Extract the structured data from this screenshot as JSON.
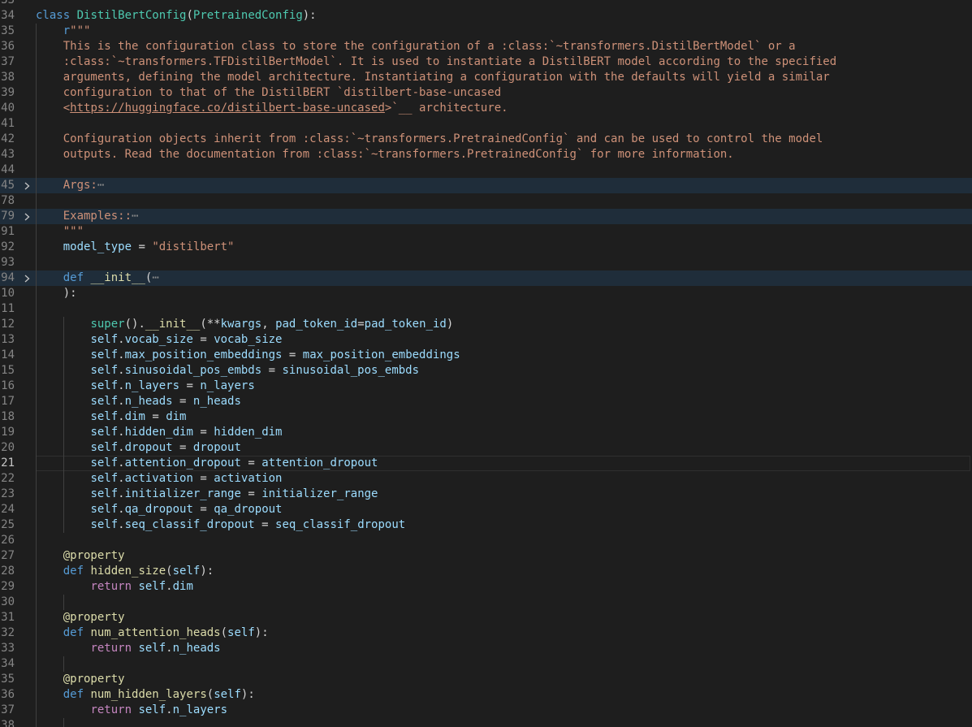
{
  "editor": {
    "language": "python",
    "active_line": "21",
    "colors": {
      "background": "#1e1e1e",
      "keyword": "#569cd6",
      "class": "#4ec9b0",
      "string": "#ce9178",
      "function": "#dcdcaa",
      "variable": "#9cdcfe",
      "control": "#c586c0",
      "folded_bg": "#1f2d3a"
    },
    "lines": [
      {
        "num": "33",
        "tokens": []
      },
      {
        "num": "34",
        "tokens": [
          [
            "kw",
            "class"
          ],
          [
            "txt",
            " "
          ],
          [
            "cls",
            "DistilBertConfig"
          ],
          [
            "txt",
            "("
          ],
          [
            "cls",
            "PretrainedConfig"
          ],
          [
            "txt",
            "):"
          ]
        ]
      },
      {
        "num": "35",
        "tokens": [
          [
            "txt",
            "    "
          ],
          [
            "kw",
            "r"
          ],
          [
            "str",
            "\"\"\""
          ]
        ]
      },
      {
        "num": "36",
        "tokens": [
          [
            "str",
            "    This is the configuration class to store the configuration of a :class:`~transformers.DistilBertModel` or a"
          ]
        ]
      },
      {
        "num": "37",
        "tokens": [
          [
            "str",
            "    :class:`~transformers.TFDistilBertModel`. It is used to instantiate a DistilBERT model according to the specified"
          ]
        ]
      },
      {
        "num": "38",
        "tokens": [
          [
            "str",
            "    arguments, defining the model architecture. Instantiating a configuration with the defaults will yield a similar"
          ]
        ]
      },
      {
        "num": "39",
        "tokens": [
          [
            "str",
            "    configuration to that of the DistilBERT `distilbert-base-uncased"
          ]
        ]
      },
      {
        "num": "40",
        "tokens": [
          [
            "str",
            "    <"
          ],
          [
            "link",
            "https://huggingface.co/distilbert-base-uncased"
          ],
          [
            "str",
            ">`__ architecture."
          ]
        ]
      },
      {
        "num": "41",
        "tokens": []
      },
      {
        "num": "42",
        "tokens": [
          [
            "str",
            "    Configuration objects inherit from :class:`~transformers.PretrainedConfig` and can be used to control the model"
          ]
        ]
      },
      {
        "num": "43",
        "tokens": [
          [
            "str",
            "    outputs. Read the documentation from :class:`~transformers.PretrainedConfig` for more information."
          ]
        ]
      },
      {
        "num": "44",
        "tokens": []
      },
      {
        "num": "45",
        "folded": true,
        "tokens": [
          [
            "str",
            "    Args:"
          ],
          [
            "ell",
            "⋯"
          ]
        ]
      },
      {
        "num": "78",
        "tokens": []
      },
      {
        "num": "79",
        "folded": true,
        "tokens": [
          [
            "str",
            "    Examples::"
          ],
          [
            "ell",
            "⋯"
          ]
        ]
      },
      {
        "num": "91",
        "tokens": [
          [
            "str",
            "    \"\"\""
          ]
        ]
      },
      {
        "num": "92",
        "tokens": [
          [
            "txt",
            "    "
          ],
          [
            "var",
            "model_type"
          ],
          [
            "txt",
            " = "
          ],
          [
            "str",
            "\"distilbert\""
          ]
        ]
      },
      {
        "num": "93",
        "tokens": []
      },
      {
        "num": "94",
        "folded": true,
        "tokens": [
          [
            "txt",
            "    "
          ],
          [
            "kw",
            "def"
          ],
          [
            "txt",
            " "
          ],
          [
            "fn",
            "__init__"
          ],
          [
            "txt",
            "("
          ],
          [
            "ell",
            "⋯"
          ]
        ]
      },
      {
        "num": "10",
        "tokens": [
          [
            "txt",
            "    ):"
          ]
        ]
      },
      {
        "num": "11",
        "tokens": []
      },
      {
        "num": "12",
        "tokens": [
          [
            "txt",
            "        "
          ],
          [
            "cls",
            "super"
          ],
          [
            "txt",
            "()."
          ],
          [
            "fn",
            "__init__"
          ],
          [
            "txt",
            "(**"
          ],
          [
            "var",
            "kwargs"
          ],
          [
            "txt",
            ", "
          ],
          [
            "var",
            "pad_token_id"
          ],
          [
            "txt",
            "="
          ],
          [
            "var",
            "pad_token_id"
          ],
          [
            "txt",
            ")"
          ]
        ]
      },
      {
        "num": "13",
        "tokens": [
          [
            "txt",
            "        "
          ],
          [
            "var",
            "self"
          ],
          [
            "txt",
            "."
          ],
          [
            "var",
            "vocab_size"
          ],
          [
            "txt",
            " = "
          ],
          [
            "var",
            "vocab_size"
          ]
        ]
      },
      {
        "num": "14",
        "tokens": [
          [
            "txt",
            "        "
          ],
          [
            "var",
            "self"
          ],
          [
            "txt",
            "."
          ],
          [
            "var",
            "max_position_embeddings"
          ],
          [
            "txt",
            " = "
          ],
          [
            "var",
            "max_position_embeddings"
          ]
        ]
      },
      {
        "num": "15",
        "tokens": [
          [
            "txt",
            "        "
          ],
          [
            "var",
            "self"
          ],
          [
            "txt",
            "."
          ],
          [
            "var",
            "sinusoidal_pos_embds"
          ],
          [
            "txt",
            " = "
          ],
          [
            "var",
            "sinusoidal_pos_embds"
          ]
        ]
      },
      {
        "num": "16",
        "tokens": [
          [
            "txt",
            "        "
          ],
          [
            "var",
            "self"
          ],
          [
            "txt",
            "."
          ],
          [
            "var",
            "n_layers"
          ],
          [
            "txt",
            " = "
          ],
          [
            "var",
            "n_layers"
          ]
        ]
      },
      {
        "num": "17",
        "tokens": [
          [
            "txt",
            "        "
          ],
          [
            "var",
            "self"
          ],
          [
            "txt",
            "."
          ],
          [
            "var",
            "n_heads"
          ],
          [
            "txt",
            " = "
          ],
          [
            "var",
            "n_heads"
          ]
        ]
      },
      {
        "num": "18",
        "tokens": [
          [
            "txt",
            "        "
          ],
          [
            "var",
            "self"
          ],
          [
            "txt",
            "."
          ],
          [
            "var",
            "dim"
          ],
          [
            "txt",
            " = "
          ],
          [
            "var",
            "dim"
          ]
        ]
      },
      {
        "num": "19",
        "tokens": [
          [
            "txt",
            "        "
          ],
          [
            "var",
            "self"
          ],
          [
            "txt",
            "."
          ],
          [
            "var",
            "hidden_dim"
          ],
          [
            "txt",
            " = "
          ],
          [
            "var",
            "hidden_dim"
          ]
        ]
      },
      {
        "num": "20",
        "tokens": [
          [
            "txt",
            "        "
          ],
          [
            "var",
            "self"
          ],
          [
            "txt",
            "."
          ],
          [
            "var",
            "dropout"
          ],
          [
            "txt",
            " = "
          ],
          [
            "var",
            "dropout"
          ]
        ]
      },
      {
        "num": "21",
        "tokens": [
          [
            "txt",
            "        "
          ],
          [
            "var",
            "self"
          ],
          [
            "txt",
            "."
          ],
          [
            "var",
            "attention_dropout"
          ],
          [
            "txt",
            " = "
          ],
          [
            "var",
            "attention_dropout"
          ]
        ]
      },
      {
        "num": "22",
        "tokens": [
          [
            "txt",
            "        "
          ],
          [
            "var",
            "self"
          ],
          [
            "txt",
            "."
          ],
          [
            "var",
            "activation"
          ],
          [
            "txt",
            " = "
          ],
          [
            "var",
            "activation"
          ]
        ]
      },
      {
        "num": "23",
        "tokens": [
          [
            "txt",
            "        "
          ],
          [
            "var",
            "self"
          ],
          [
            "txt",
            "."
          ],
          [
            "var",
            "initializer_range"
          ],
          [
            "txt",
            " = "
          ],
          [
            "var",
            "initializer_range"
          ]
        ]
      },
      {
        "num": "24",
        "tokens": [
          [
            "txt",
            "        "
          ],
          [
            "var",
            "self"
          ],
          [
            "txt",
            "."
          ],
          [
            "var",
            "qa_dropout"
          ],
          [
            "txt",
            " = "
          ],
          [
            "var",
            "qa_dropout"
          ]
        ]
      },
      {
        "num": "25",
        "tokens": [
          [
            "txt",
            "        "
          ],
          [
            "var",
            "self"
          ],
          [
            "txt",
            "."
          ],
          [
            "var",
            "seq_classif_dropout"
          ],
          [
            "txt",
            " = "
          ],
          [
            "var",
            "seq_classif_dropout"
          ]
        ]
      },
      {
        "num": "26",
        "tokens": []
      },
      {
        "num": "27",
        "tokens": [
          [
            "txt",
            "    "
          ],
          [
            "fn",
            "@property"
          ]
        ]
      },
      {
        "num": "28",
        "tokens": [
          [
            "txt",
            "    "
          ],
          [
            "kw",
            "def"
          ],
          [
            "txt",
            " "
          ],
          [
            "fn",
            "hidden_size"
          ],
          [
            "txt",
            "("
          ],
          [
            "var",
            "self"
          ],
          [
            "txt",
            "):"
          ]
        ]
      },
      {
        "num": "29",
        "tokens": [
          [
            "txt",
            "        "
          ],
          [
            "ctl",
            "return"
          ],
          [
            "txt",
            " "
          ],
          [
            "var",
            "self"
          ],
          [
            "txt",
            "."
          ],
          [
            "var",
            "dim"
          ]
        ]
      },
      {
        "num": "30",
        "tokens": []
      },
      {
        "num": "31",
        "tokens": [
          [
            "txt",
            "    "
          ],
          [
            "fn",
            "@property"
          ]
        ]
      },
      {
        "num": "32",
        "tokens": [
          [
            "txt",
            "    "
          ],
          [
            "kw",
            "def"
          ],
          [
            "txt",
            " "
          ],
          [
            "fn",
            "num_attention_heads"
          ],
          [
            "txt",
            "("
          ],
          [
            "var",
            "self"
          ],
          [
            "txt",
            "):"
          ]
        ]
      },
      {
        "num": "33",
        "tokens": [
          [
            "txt",
            "        "
          ],
          [
            "ctl",
            "return"
          ],
          [
            "txt",
            " "
          ],
          [
            "var",
            "self"
          ],
          [
            "txt",
            "."
          ],
          [
            "var",
            "n_heads"
          ]
        ]
      },
      {
        "num": "34",
        "tokens": []
      },
      {
        "num": "35",
        "tokens": [
          [
            "txt",
            "    "
          ],
          [
            "fn",
            "@property"
          ]
        ]
      },
      {
        "num": "36",
        "tokens": [
          [
            "txt",
            "    "
          ],
          [
            "kw",
            "def"
          ],
          [
            "txt",
            " "
          ],
          [
            "fn",
            "num_hidden_layers"
          ],
          [
            "txt",
            "("
          ],
          [
            "var",
            "self"
          ],
          [
            "txt",
            "):"
          ]
        ]
      },
      {
        "num": "37",
        "tokens": [
          [
            "txt",
            "        "
          ],
          [
            "ctl",
            "return"
          ],
          [
            "txt",
            " "
          ],
          [
            "var",
            "self"
          ],
          [
            "txt",
            "."
          ],
          [
            "var",
            "n_layers"
          ]
        ]
      },
      {
        "num": "38",
        "tokens": []
      }
    ]
  }
}
